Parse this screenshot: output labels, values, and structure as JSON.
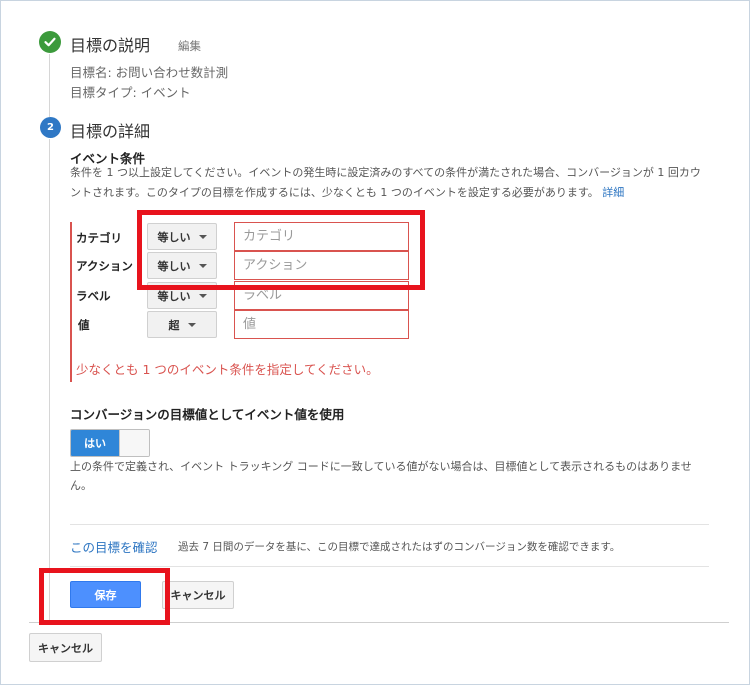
{
  "step1": {
    "title": "目標の説明",
    "edit_label": "編集",
    "goal_name": "目標名: お問い合わせ数計測",
    "goal_type": "目標タイプ: イベント"
  },
  "step2": {
    "number": "2",
    "title": "目標の詳細"
  },
  "event_conditions": {
    "heading": "イベント条件",
    "description_line1": "条件を 1 つ以上設定してください。イベントの発生時に設定済みのすべての条件が満たされた場合、コンバージョンが 1 回カウ",
    "description_line2": "ントされます。このタイプの目標を作成するには、少なくとも 1 つのイベントを設定する必要があります。",
    "details_link": "詳細",
    "rows": [
      {
        "label": "カテゴリ",
        "operator": "等しい",
        "placeholder": "カテゴリ"
      },
      {
        "label": "アクション",
        "operator": "等しい",
        "placeholder": "アクション"
      },
      {
        "label": "ラベル",
        "operator": "等しい",
        "placeholder": "ラベル"
      },
      {
        "label": "値",
        "operator": "超",
        "placeholder": "値"
      }
    ],
    "error": "少なくとも 1 つのイベント条件を指定してください。"
  },
  "event_value": {
    "heading": "コンバージョンの目標値としてイベント値を使用",
    "toggle_label": "はい",
    "toggle_state": "on",
    "note_line1": "上の条件で定義され、イベント トラッキング コードに一致している値がない場合は、目標値として表示されるものはありませ",
    "note_line2": "ん。"
  },
  "verify": {
    "link": "この目標を確認",
    "description": "過去 7 日間のデータを基に、この目標で達成されたはずのコンバージョン数を確認できます。"
  },
  "buttons": {
    "save": "保存",
    "cancel_inner": "キャンセル",
    "cancel_outer": "キャンセル"
  },
  "colors": {
    "accent_blue": "#2f78c5",
    "success_green": "#3c9a3c",
    "error_red": "#d9534f",
    "highlight_red": "#e8131d",
    "primary_button": "#4d90fe"
  }
}
